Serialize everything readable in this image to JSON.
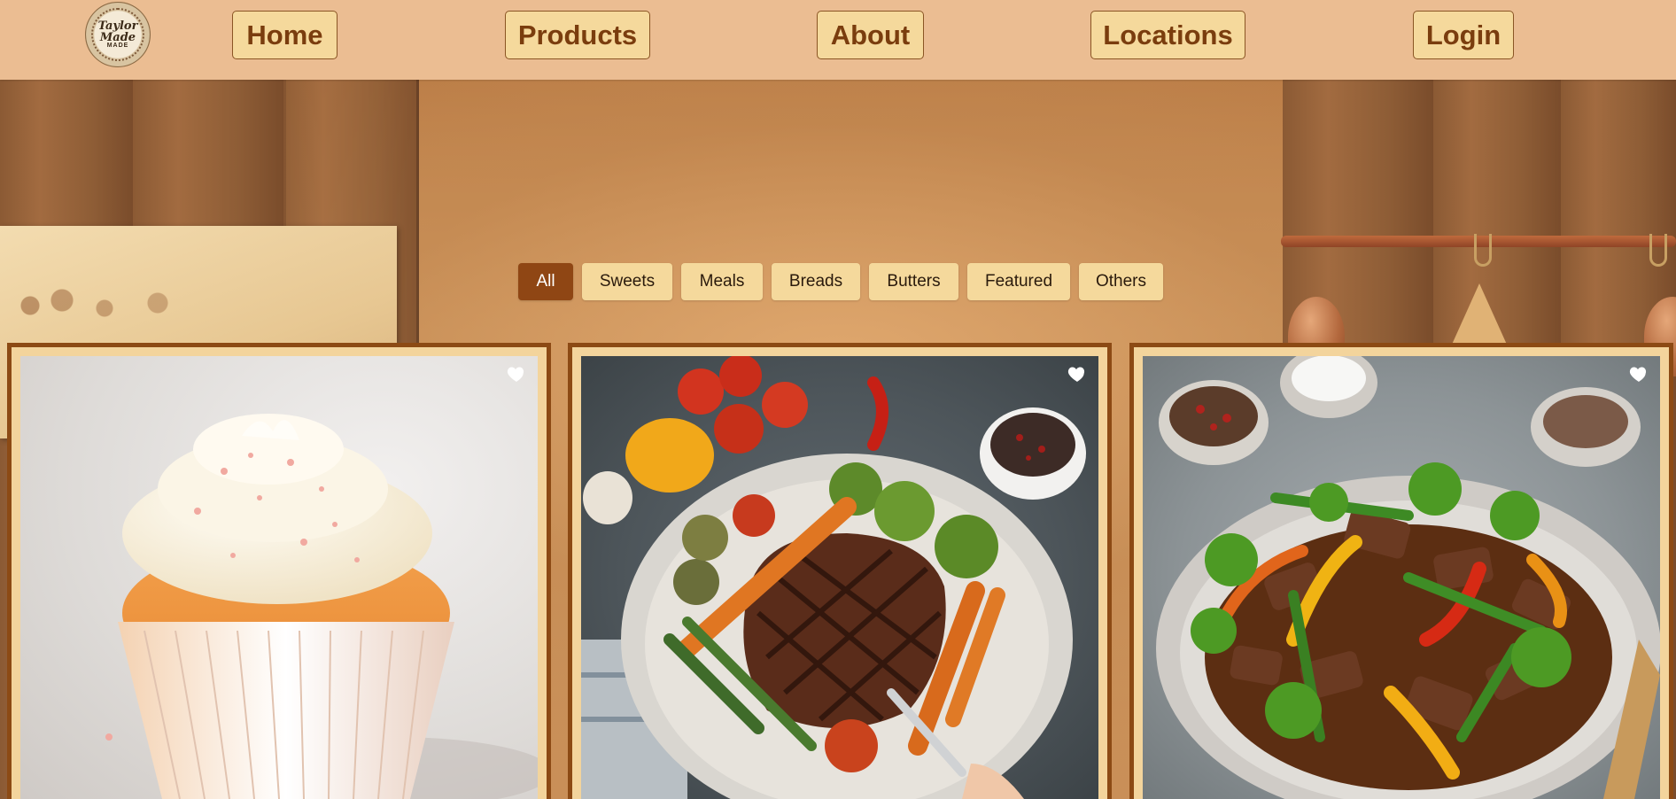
{
  "header": {
    "logo_text": "Taylor Made",
    "logo_sub": "MADE",
    "nav": [
      {
        "label": "Home"
      },
      {
        "label": "Products"
      },
      {
        "label": "About"
      },
      {
        "label": "Locations"
      },
      {
        "label": "Login"
      }
    ]
  },
  "filters": {
    "items": [
      {
        "label": "All",
        "active": true
      },
      {
        "label": "Sweets",
        "active": false
      },
      {
        "label": "Meals",
        "active": false
      },
      {
        "label": "Breads",
        "active": false
      },
      {
        "label": "Butters",
        "active": false
      },
      {
        "label": "Featured",
        "active": false
      },
      {
        "label": "Others",
        "active": false
      }
    ]
  },
  "products": [
    {
      "image": "cupcake-with-vanilla-frosting",
      "icon": "heart-icon"
    },
    {
      "image": "grilled-steak-with-vegetables",
      "icon": "heart-icon"
    },
    {
      "image": "beef-and-vegetable-stir-fry",
      "icon": "heart-icon"
    }
  ],
  "colors": {
    "header_bg": "#ebbd92",
    "nav_button_bg": "#f5d99c",
    "nav_text": "#7a3d0e",
    "filter_active_bg": "#8f4614",
    "card_border": "#8c4a14",
    "card_bg": "#f3d49c"
  }
}
